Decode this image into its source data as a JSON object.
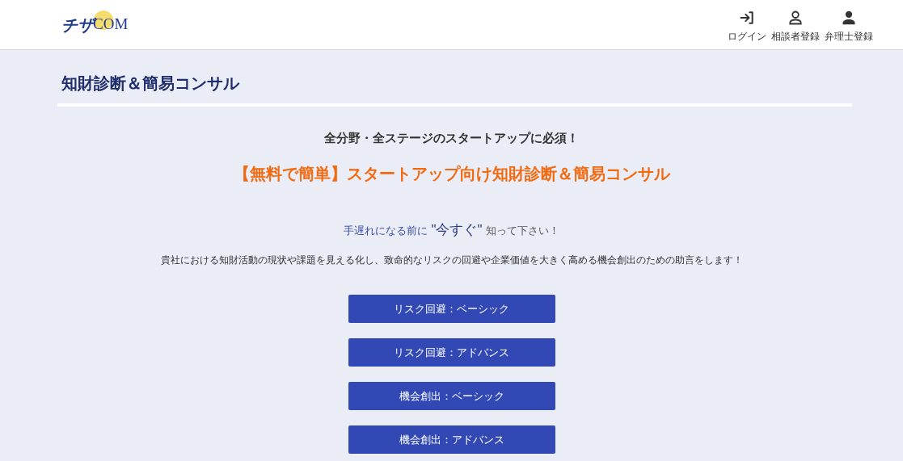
{
  "header": {
    "logo": {
      "kana": "チザ",
      "latin": "COM"
    },
    "nav": [
      {
        "kind": "login",
        "label": "ログイン"
      },
      {
        "kind": "outline-user",
        "label": "相談者登録"
      },
      {
        "kind": "filled-user",
        "label": "弁理士登録"
      }
    ]
  },
  "page_title": "知財診断＆簡易コンサル",
  "tagline": "全分野・全ステージのスタートアップに必須！",
  "headline": "【無料で簡単】スタートアップ向け知財診断＆簡易コンサル",
  "hook": [
    {
      "kind": "accent",
      "text": "手遅れになる前に"
    },
    {
      "kind": "emphasis",
      "text": "\"今すぐ\""
    },
    {
      "kind": "plain",
      "text": "知って下さい！"
    }
  ],
  "description": "貴社における知財活動の現状や課題を見える化し、致命的なリスクの回避や企業価値を大きく高める機会創出のための助言をします！",
  "buttons": [
    "リスク回避：ベーシック",
    "リスク回避：アドバンス",
    "機会創出：ベーシック",
    "機会創出：アドバンス"
  ]
}
